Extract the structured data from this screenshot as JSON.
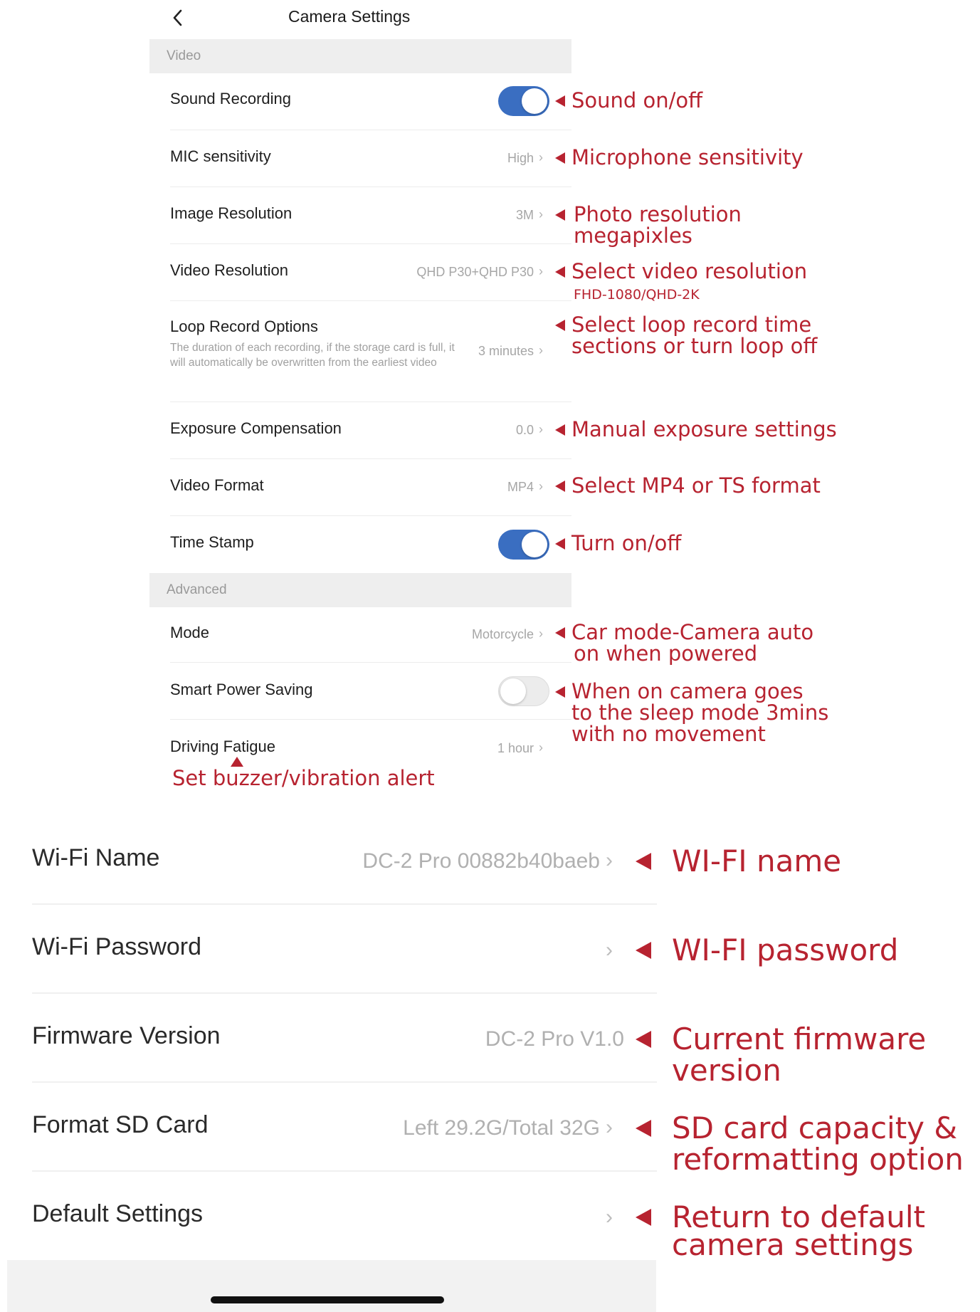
{
  "header": {
    "title": "Camera Settings",
    "back_icon": "chevron-left-icon"
  },
  "sections": {
    "video": "Video",
    "advanced": "Advanced"
  },
  "rows": {
    "sound_recording": {
      "label": "Sound Recording",
      "toggle": "on"
    },
    "mic_sensitivity": {
      "label": "MIC sensitivity",
      "value": "High"
    },
    "image_resolution": {
      "label": "Image Resolution",
      "value": "3M"
    },
    "video_resolution": {
      "label": "Video Resolution",
      "value": "QHD P30+QHD P30"
    },
    "loop_record": {
      "label": "Loop Record Options",
      "value": "3 minutes",
      "description": "The duration of each recording, if the storage card is full, it will automatically be overwritten from the earliest video"
    },
    "exposure": {
      "label": "Exposure Compensation",
      "value": "0.0"
    },
    "video_format": {
      "label": "Video Format",
      "value": "MP4"
    },
    "time_stamp": {
      "label": "Time Stamp",
      "toggle": "on"
    },
    "mode": {
      "label": "Mode",
      "value": "Motorcycle"
    },
    "smart_power": {
      "label": "Smart Power Saving",
      "toggle": "off"
    },
    "driving_fatigue": {
      "label": "Driving Fatigue",
      "value": "1 hour"
    }
  },
  "chevron": "›",
  "annotations": {
    "sound": "Sound on/off",
    "mic": "Microphone sensitivity",
    "photo_1": "Photo resolution",
    "photo_2": "megapixles",
    "video_1": "Select video resolution",
    "video_2": "FHD-1080/QHD-2K",
    "loop_1": "Select loop record time",
    "loop_2": "sections or turn loop off",
    "exposure": "Manual exposure settings",
    "format": "Select MP4 or TS format",
    "timestamp": "Turn on/off",
    "mode_1": "Car mode-Camera auto",
    "mode_2": "on when powered",
    "power_1": "When on camera goes",
    "power_2": "to the sleep mode 3mins",
    "power_3": "with no movement",
    "fatigue": "Set buzzer/vibration alert",
    "wifi_name": "WI-FI name",
    "wifi_password": "WI-FI password",
    "firmware_1": "Current firmware",
    "firmware_2": "version",
    "sd_1": "SD card capacity &",
    "sd_2": "reformatting option",
    "default_1": "Return to default",
    "default_2": "camera settings"
  },
  "bottom": {
    "wifi_name": {
      "label": "Wi-Fi Name",
      "value": "DC-2 Pro 00882b40baeb"
    },
    "wifi_password": {
      "label": "Wi-Fi Password"
    },
    "firmware": {
      "label": "Firmware Version",
      "value": "DC-2 Pro V1.0"
    },
    "format_sd": {
      "label": "Format SD Card",
      "value": "Left 29.2G/Total 32G"
    },
    "default": {
      "label": "Default Settings"
    }
  },
  "colors": {
    "accent_toggle": "#3a6ec1",
    "annotation": "#b72330"
  }
}
